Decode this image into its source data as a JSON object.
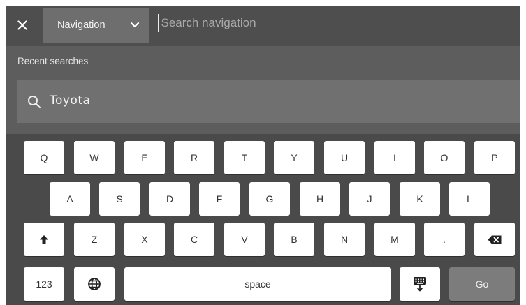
{
  "topbar": {
    "close_icon": "close-icon",
    "category_selected": "Navigation",
    "category_chevron_icon": "chevron-down-icon",
    "search_placeholder": "Search navigation"
  },
  "recent": {
    "label": "Recent searches",
    "items": [
      {
        "icon": "search-icon",
        "text": "Toyota"
      }
    ]
  },
  "keyboard": {
    "row1": [
      "Q",
      "W",
      "E",
      "R",
      "T",
      "Y",
      "U",
      "I",
      "O",
      "P"
    ],
    "row2": [
      "A",
      "S",
      "D",
      "F",
      "G",
      "H",
      "J",
      "K",
      "L"
    ],
    "row3": [
      "Z",
      "X",
      "C",
      "V",
      "B",
      "N",
      "M",
      "."
    ],
    "shift_icon": "shift-arrow-icon",
    "backspace_icon": "backspace-icon",
    "numbers_label": "123",
    "globe_icon": "globe-icon",
    "space_label": "space",
    "hide_keyboard_icon": "hide-keyboard-icon",
    "go_label": "Go"
  },
  "colors": {
    "screen_bg": "#5d5d5d",
    "topbar_bg": "#4e4e4e",
    "selector_bg": "#6e6e6e",
    "recent_item_bg": "#707070",
    "keyboard_bg": "#4a4a4a",
    "key_bg": "#ffffff",
    "go_key_bg": "#7c7c7c"
  }
}
